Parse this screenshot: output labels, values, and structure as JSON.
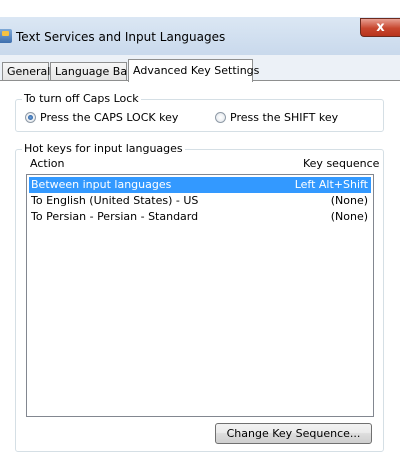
{
  "window": {
    "title": "Text Services and Input Languages",
    "close_label": "x"
  },
  "tabs": [
    {
      "label": "General",
      "active": false
    },
    {
      "label": "Language Bar",
      "active": false
    },
    {
      "label": "Advanced Key Settings",
      "active": true
    }
  ],
  "caps_lock": {
    "legend": "To turn off Caps Lock",
    "option_caps": "Press the CAPS LOCK key",
    "option_shift": "Press the SHIFT key",
    "selected": "caps"
  },
  "hotkeys": {
    "legend": "Hot keys for input languages",
    "col_action": "Action",
    "col_sequence": "Key sequence",
    "rows": [
      {
        "action": "Between input languages",
        "sequence": "Left Alt+Shift",
        "selected": true
      },
      {
        "action": "To English (United States) - US",
        "sequence": "(None)",
        "selected": false
      },
      {
        "action": "To Persian - Persian - Standard",
        "sequence": "(None)",
        "selected": false
      }
    ],
    "change_button": "Change Key Sequence..."
  },
  "colors": {
    "selection": "#3399ff",
    "close_button": "#c7462e"
  }
}
